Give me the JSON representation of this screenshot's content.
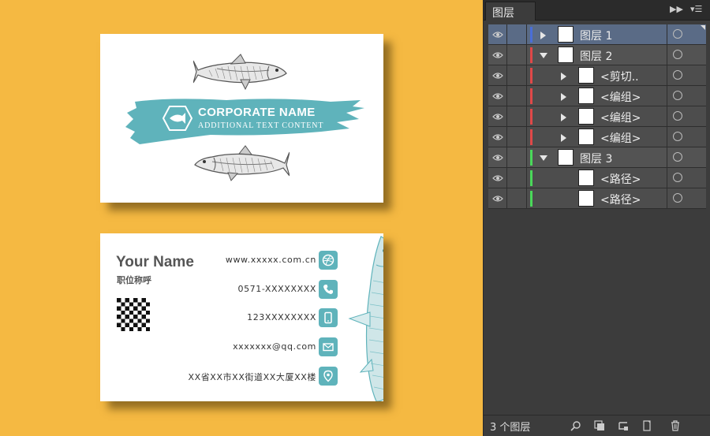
{
  "canvas": {
    "front_card": {
      "company_name": "CORPORATE NAME",
      "company_subtitle": "ADDITIONAL TEXT CONTENT",
      "brand_color": "#5fb3bb"
    },
    "back_card": {
      "name": "Your Name",
      "job_title": "职位称呼",
      "contacts": [
        {
          "icon": "dribbble-icon",
          "text": "www.xxxxx.com.cn"
        },
        {
          "icon": "phone-icon",
          "text": "0571-XXXXXXXX"
        },
        {
          "icon": "mobile-icon",
          "text": "123XXXXXXXX"
        },
        {
          "icon": "mail-icon",
          "text": "xxxxxxx@qq.com"
        },
        {
          "icon": "location-pin-icon",
          "text": "XX省XX市XX街道XX大厦XX楼"
        }
      ]
    }
  },
  "layers_panel": {
    "tab_title": "图层",
    "footer_count": "3 个图层",
    "rows": [
      {
        "label": "图层 1",
        "expanded": false,
        "color": "#4a6ed8",
        "selected": true
      },
      {
        "label": "图层 2",
        "expanded": true,
        "color": "#e04848",
        "selected": false
      },
      {
        "label": "<剪切..",
        "expanded": false,
        "color": "#e04848",
        "selected": false
      },
      {
        "label": "<编组>",
        "expanded": false,
        "color": "#e04848",
        "selected": false
      },
      {
        "label": "<编组>",
        "expanded": false,
        "color": "#e04848",
        "selected": false
      },
      {
        "label": "<编组>",
        "expanded": false,
        "color": "#e04848",
        "selected": false
      },
      {
        "label": "图层 3",
        "expanded": true,
        "color": "#4ad85a",
        "selected": false
      },
      {
        "label": "<路径>",
        "expanded": false,
        "color": "#4ad85a",
        "selected": false
      },
      {
        "label": "<路径>",
        "expanded": false,
        "color": "#4ad85a",
        "selected": false
      }
    ]
  }
}
